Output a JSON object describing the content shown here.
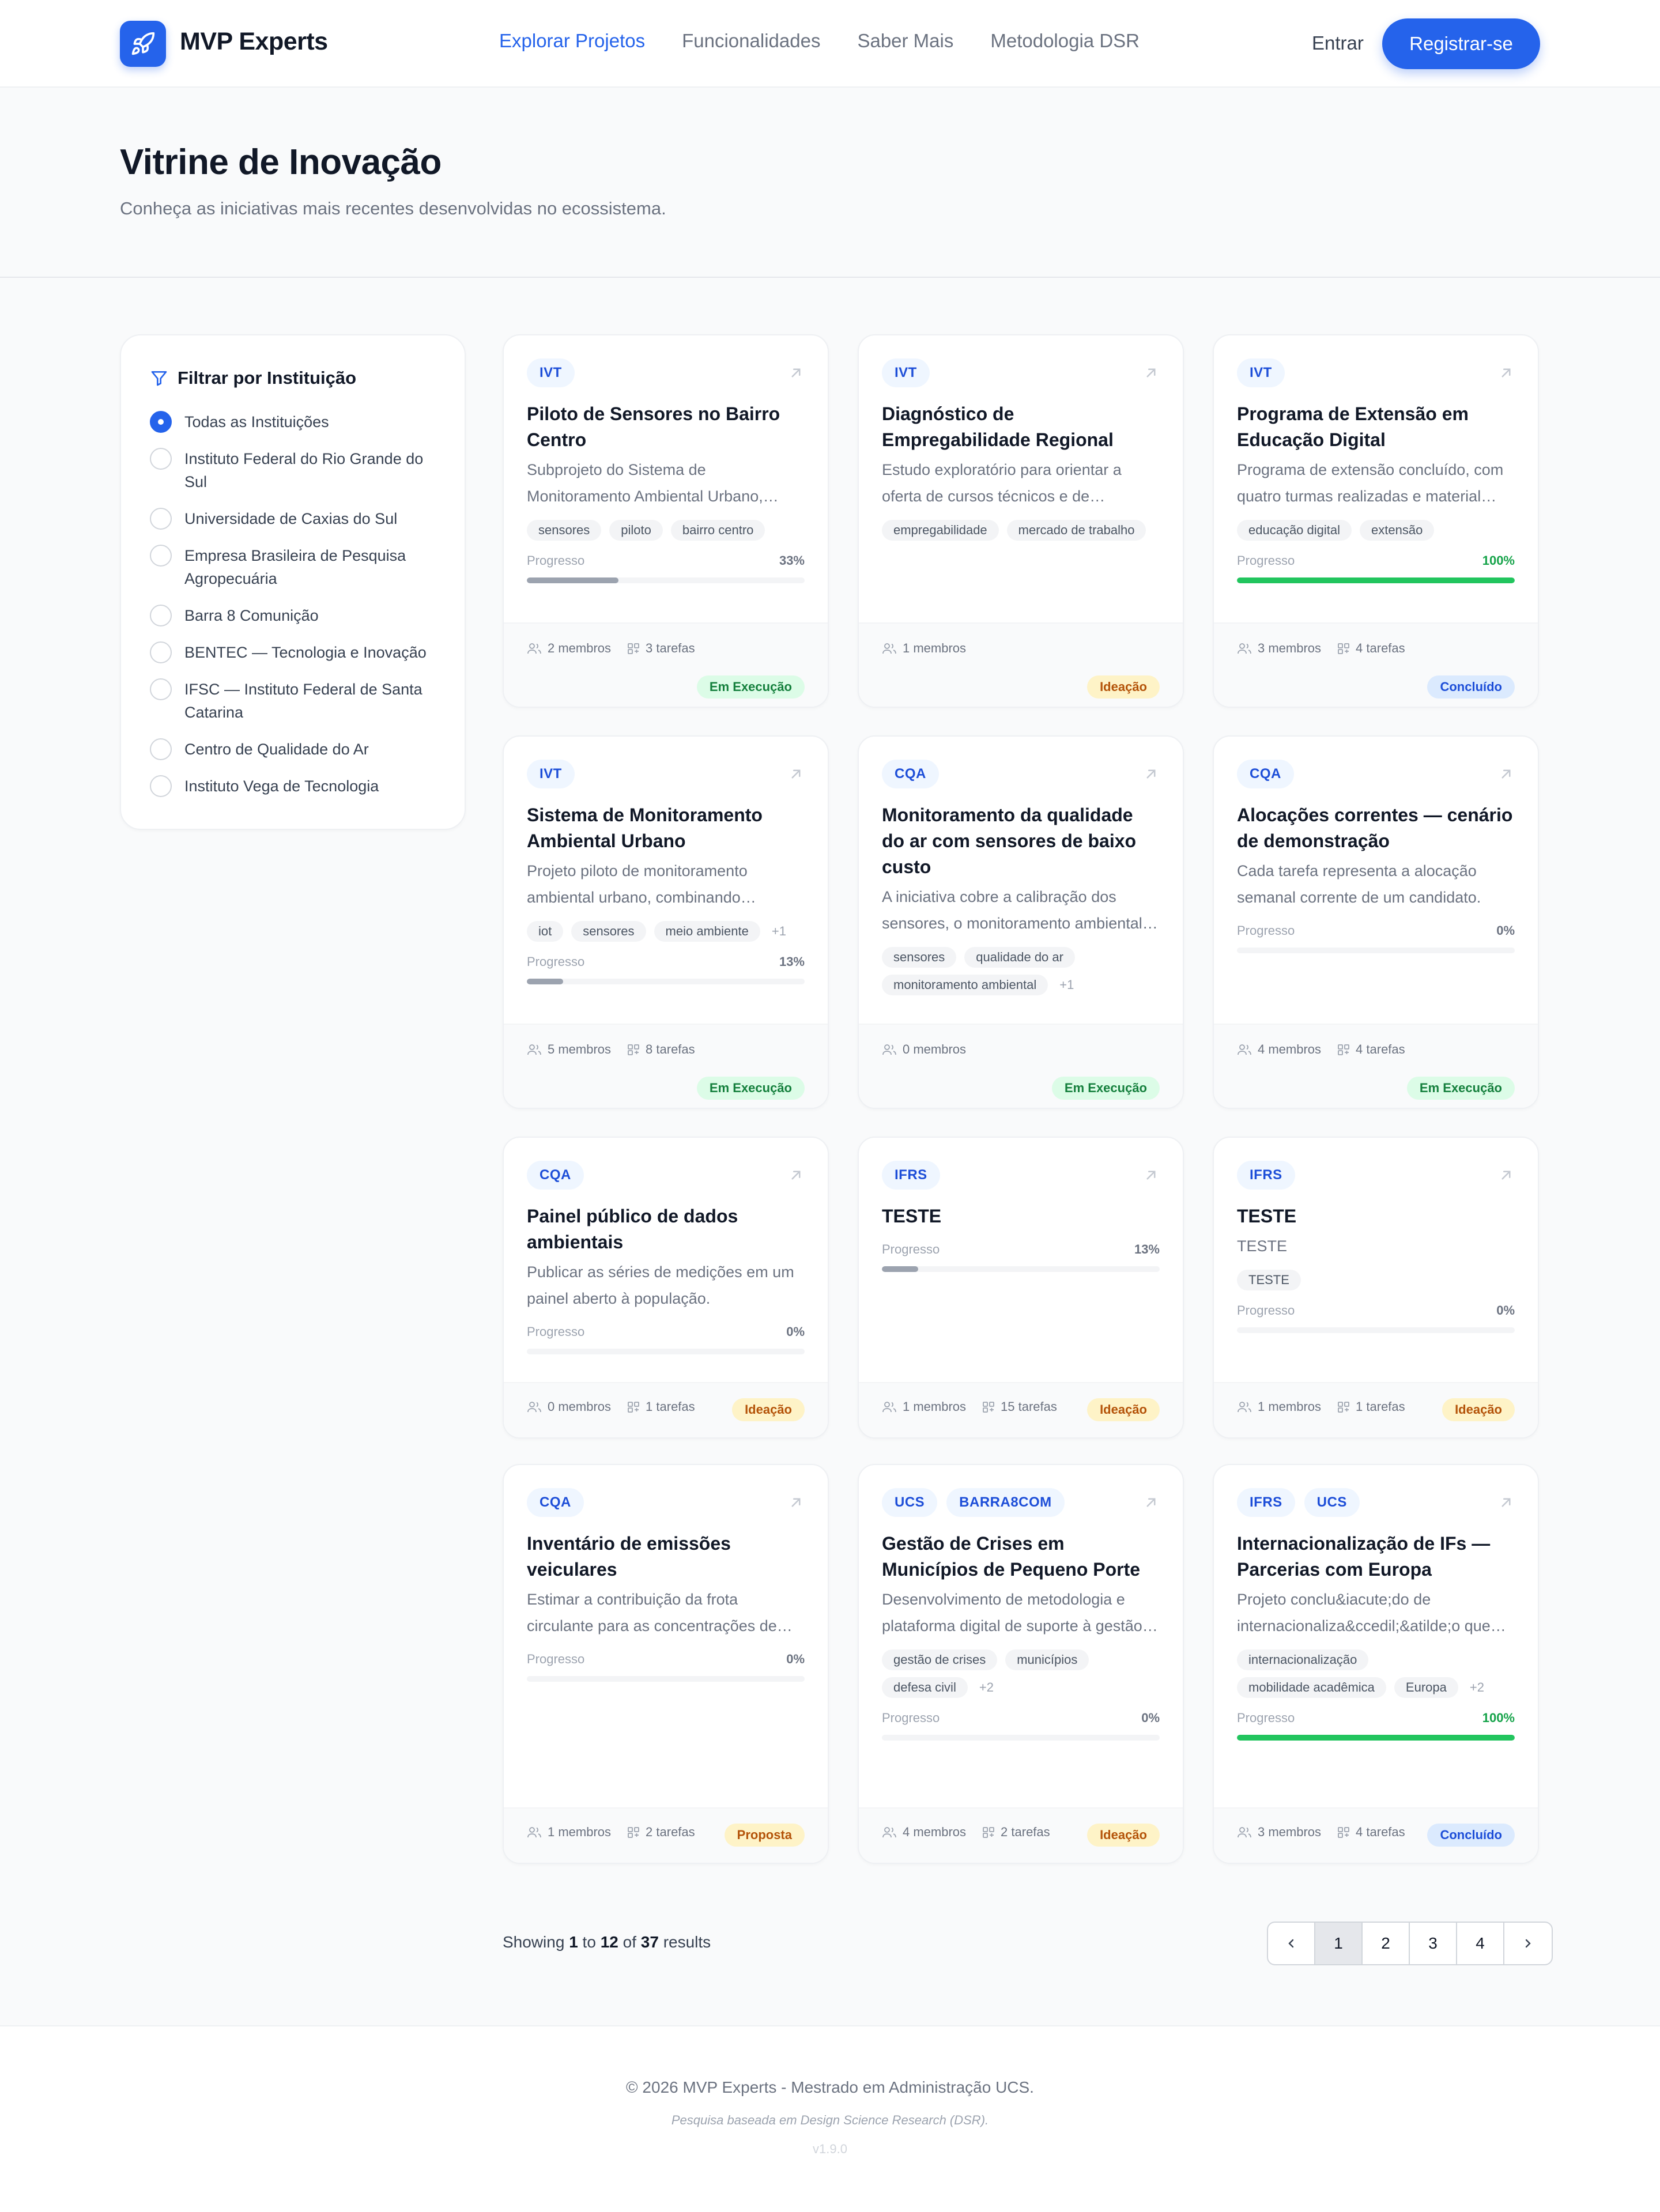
{
  "brand": {
    "name": "MVP Experts"
  },
  "nav": {
    "items": [
      "Explorar Projetos",
      "Funcionalidades",
      "Saber Mais",
      "Metodologia DSR"
    ],
    "login": "Entrar",
    "register": "Registrar-se"
  },
  "hero": {
    "title": "Vitrine de Inovação",
    "subtitle": "Conheça as iniciativas mais recentes desenvolvidas no ecossistema."
  },
  "filter": {
    "title": "Filtrar por Instituição",
    "selected_index": 0,
    "options": [
      "Todas as Instituições",
      "Instituto Federal do Rio Grande do Sul",
      "Universidade de Caxias do Sul",
      "Empresa Brasileira de Pesquisa Agropecuária",
      "Barra 8 Comunição",
      "BENTEC — Tecnologia e Inovação",
      "IFSC — Instituto Federal de Santa Catarina",
      "Centro de Qualidade do Ar",
      "Instituto Vega de Tecnologia"
    ]
  },
  "labels": {
    "progress": "Progresso",
    "members": "membros",
    "tasks": "tarefas"
  },
  "projects": [
    {
      "badges": [
        "IVT"
      ],
      "title": "Piloto de Sensores no Bairro Centro",
      "desc": "Subprojeto do Sistema de Monitoramento Ambiental Urbano, focado no bairro centro.",
      "tags": [
        "sensores",
        "piloto",
        "bairro centro"
      ],
      "more": "",
      "progress": 33,
      "members": 2,
      "tasks": 3,
      "status": "Em Execução",
      "status_kind": "exec"
    },
    {
      "badges": [
        "IVT"
      ],
      "title": "Diagnóstico de Empregabilidade Regional",
      "desc": "Estudo exploratório para orientar a oferta de cursos técnicos e de qualificação.",
      "tags": [
        "empregabilidade",
        "mercado de trabalho"
      ],
      "more": "",
      "progress": null,
      "members": 1,
      "tasks": null,
      "status": "Ideação",
      "status_kind": "idea"
    },
    {
      "badges": [
        "IVT"
      ],
      "title": "Programa de Extensão em Educação Digital",
      "desc": "Programa de extensão concluído, com quatro turmas realizadas e material publicado.",
      "tags": [
        "educação digital",
        "extensão"
      ],
      "more": "",
      "progress": 100,
      "members": 3,
      "tasks": 4,
      "status": "Concluído",
      "status_kind": "done"
    },
    {
      "badges": [
        "IVT"
      ],
      "title": "Sistema de Monitoramento Ambiental Urbano",
      "desc": "Projeto piloto de monitoramento ambiental urbano, combinando sensores e dados abertos.",
      "tags": [
        "iot",
        "sensores",
        "meio ambiente"
      ],
      "more": "+1",
      "progress": 13,
      "members": 5,
      "tasks": 8,
      "status": "Em Execução",
      "status_kind": "exec"
    },
    {
      "badges": [
        "CQA"
      ],
      "title": "Monitoramento da qualidade do ar com sensores de baixo custo",
      "desc": "A iniciativa cobre a calibração dos sensores, o monitoramento ambiental e a análise.",
      "tags": [
        "sensores",
        "qualidade do ar",
        "monitoramento ambiental"
      ],
      "more": "+1",
      "progress": null,
      "members": 0,
      "tasks": null,
      "status": "Em Execução",
      "status_kind": "exec"
    },
    {
      "badges": [
        "CQA"
      ],
      "title": "Alocações correntes — cenário de demonstração",
      "desc": "Cada tarefa representa a alocação semanal corrente de um candidato.",
      "tags": [],
      "more": "",
      "progress": 0,
      "members": 4,
      "tasks": 4,
      "status": "Em Execução",
      "status_kind": "exec"
    },
    {
      "badges": [
        "CQA"
      ],
      "title": "Painel público de dados ambientais",
      "desc": "Publicar as séries de medições em um painel aberto à população.",
      "tags": [],
      "more": "",
      "progress": 0,
      "members": 0,
      "tasks": 1,
      "status": "Ideação",
      "status_kind": "idea"
    },
    {
      "badges": [
        "IFRS"
      ],
      "title": "TESTE",
      "desc": "",
      "tags": [],
      "more": "",
      "progress": 13,
      "members": 1,
      "tasks": 15,
      "status": "Ideação",
      "status_kind": "idea"
    },
    {
      "badges": [
        "IFRS"
      ],
      "title": "TESTE",
      "desc": "TESTE",
      "tags": [
        "TESTE"
      ],
      "more": "",
      "progress": 0,
      "members": 1,
      "tasks": 1,
      "status": "Ideação",
      "status_kind": "idea"
    },
    {
      "badges": [
        "CQA"
      ],
      "title": "Inventário de emissões veiculares",
      "desc": "Estimar a contribuição da frota circulante para as concentrações de poluentes.",
      "tags": [],
      "more": "",
      "progress": 0,
      "members": 1,
      "tasks": 2,
      "status": "Proposta",
      "status_kind": "prop"
    },
    {
      "badges": [
        "UCS",
        "BARRA8COM"
      ],
      "title": "Gestão de Crises em Municípios de Pequeno Porte",
      "desc": "Desenvolvimento de metodologia e plataforma digital de suporte à gestão de crises.",
      "tags": [
        "gestão de crises",
        "municípios",
        "defesa civil"
      ],
      "more": "+2",
      "progress": 0,
      "members": 4,
      "tasks": 2,
      "status": "Ideação",
      "status_kind": "idea"
    },
    {
      "badges": [
        "IFRS",
        "UCS"
      ],
      "title": "Internacionalização de IFs — Parcerias com Europa",
      "desc": "Projeto conclu&iacute;do de internacionaliza&ccedil;&atilde;o que estabeleceu parcerias.",
      "tags": [
        "internacionalização",
        "mobilidade acadêmica",
        "Europa"
      ],
      "more": "+2",
      "progress": 100,
      "members": 3,
      "tasks": 4,
      "status": "Concluído",
      "status_kind": "done"
    }
  ],
  "results": {
    "prefix": "Showing",
    "from": "1",
    "to_word": "to",
    "to": "12",
    "of_word": "of",
    "total": "37",
    "suffix": "results"
  },
  "pagination": {
    "pages": [
      "1",
      "2",
      "3",
      "4"
    ],
    "current": "1"
  },
  "footer": {
    "copyright": "© 2026 MVP Experts - Mestrado em Administração UCS.",
    "note": "Pesquisa baseada em Design Science Research (DSR).",
    "version": "v1.9.0"
  },
  "colors": {
    "accent": "#2563eb",
    "success": "#22c55e",
    "warning": "#b45309"
  }
}
